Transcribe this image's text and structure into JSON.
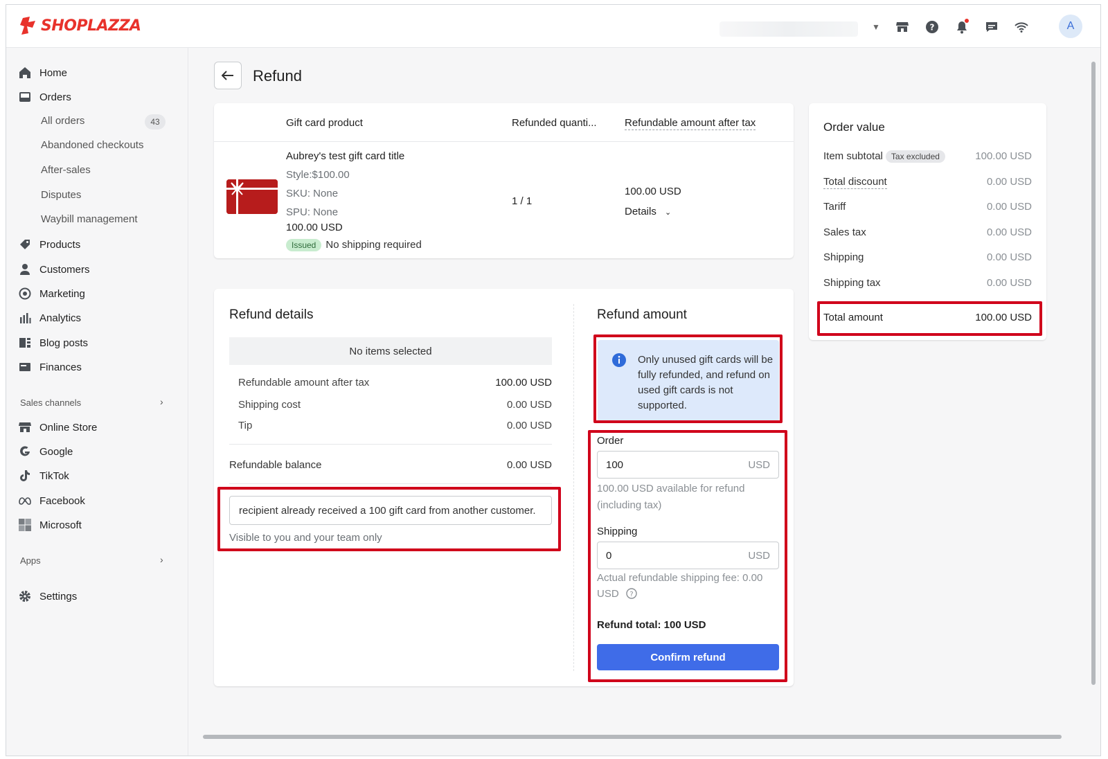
{
  "brand": {
    "name": "SHOPLAZZA",
    "color": "#e8322b"
  },
  "topbar": {
    "icons": [
      "store-icon",
      "help-icon",
      "bell-icon",
      "chat-icon",
      "wifi-icon"
    ],
    "avatar_initial": "A"
  },
  "sidebar": {
    "home": "Home",
    "orders": "Orders",
    "order_sub": [
      {
        "label": "All orders",
        "count": "43"
      },
      {
        "label": "Abandoned checkouts"
      },
      {
        "label": "After-sales"
      },
      {
        "label": "Disputes"
      },
      {
        "label": "Waybill management"
      }
    ],
    "products": "Products",
    "customers": "Customers",
    "marketing": "Marketing",
    "analytics": "Analytics",
    "blog": "Blog posts",
    "finances": "Finances",
    "sales_channels_label": "Sales channels",
    "channels": [
      "Online Store",
      "Google",
      "TikTok",
      "Facebook",
      "Microsoft"
    ],
    "apps_label": "Apps",
    "settings": "Settings"
  },
  "page": {
    "title": "Refund"
  },
  "product_table": {
    "headers": {
      "product": "Gift card product",
      "quantity": "Refunded quanti...",
      "amount": "Refundable amount after tax"
    },
    "row": {
      "title": "Aubrey's test gift card title",
      "style": "Style:$100.00",
      "sku": "SKU: None",
      "spu": "SPU: None",
      "price": "100.00 USD",
      "status_badge": "Issued",
      "shipping_note": "No shipping required",
      "quantity": "1 / 1",
      "amount": "100.00 USD",
      "details_label": "Details"
    }
  },
  "refund_details": {
    "title": "Refund details",
    "no_items": "No items selected",
    "lines": [
      {
        "label": "Refundable amount after tax",
        "value": "100.00 USD"
      },
      {
        "label": "Shipping cost",
        "value": "0.00 USD"
      },
      {
        "label": "Tip",
        "value": "0.00 USD"
      }
    ],
    "balance_label": "Refundable balance",
    "balance_value": "0.00 USD",
    "note_value": "recipient already received a 100 gift card from another customer.",
    "note_help": "Visible to you and your team only"
  },
  "refund_amount": {
    "title": "Refund amount",
    "info_text": "Only unused gift cards will be fully refunded, and refund on used gift cards is not supported.",
    "order_label": "Order",
    "order_value": "100",
    "currency": "USD",
    "order_help": "100.00 USD available for refund (including tax)",
    "shipping_label": "Shipping",
    "shipping_value": "0",
    "shipping_help_1": "Actual refundable shipping fee: 0.00",
    "shipping_help_2": "USD",
    "total": "Refund total: 100 USD",
    "confirm_label": "Confirm refund",
    "accent": "#3f6ce8"
  },
  "order_value": {
    "title": "Order value",
    "tax_badge": "Tax excluded",
    "lines": [
      {
        "label": "Item subtotal",
        "value": "100.00 USD"
      },
      {
        "label": "Total discount",
        "value": "0.00 USD"
      },
      {
        "label": "Tariff",
        "value": "0.00 USD"
      },
      {
        "label": "Sales tax",
        "value": "0.00 USD"
      },
      {
        "label": "Shipping",
        "value": "0.00 USD"
      },
      {
        "label": "Shipping tax",
        "value": "0.00 USD"
      }
    ],
    "total_label": "Total amount",
    "total_value": "100.00 USD"
  },
  "highlight_color": "#d0021b"
}
